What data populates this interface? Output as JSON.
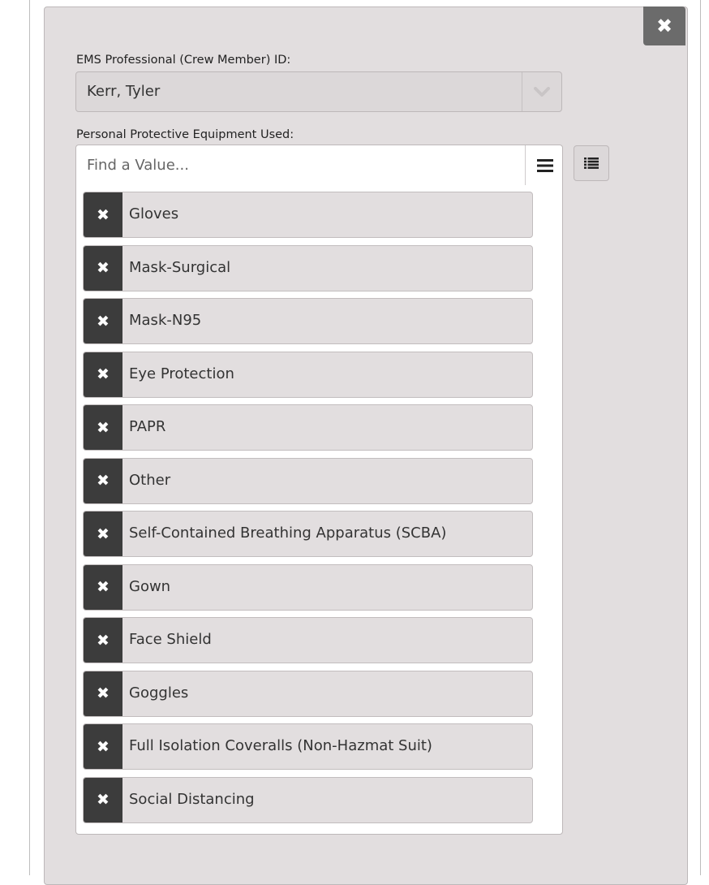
{
  "panel": {
    "close_glyph": "✖"
  },
  "crew_member": {
    "label": "EMS Professional (Crew Member) ID:",
    "selected_value": "Kerr, Tyler"
  },
  "ppe": {
    "label": "Personal Protective Equipment Used:",
    "search_placeholder": "Find a Value...",
    "remove_glyph": "✖",
    "items": [
      "Gloves",
      "Mask-Surgical",
      "Mask-N95",
      "Eye Protection",
      "PAPR",
      "Other",
      "Self-Contained Breathing Apparatus (SCBA)",
      "Gown",
      "Face Shield",
      "Goggles",
      "Full Isolation Coveralls (Non-Hazmat Suit)",
      "Social Distancing"
    ]
  },
  "icons": {
    "panel_close": "close-icon",
    "select_dropdown": "chevron-down-icon",
    "value_menu": "hamburger-menu-icon",
    "list_view": "list-icon",
    "chip_remove": "remove-icon"
  },
  "colors": {
    "panel_background": "#e2dedf",
    "close_button": "#6b6b6b",
    "chip_remove_background": "#3c3c3c"
  }
}
